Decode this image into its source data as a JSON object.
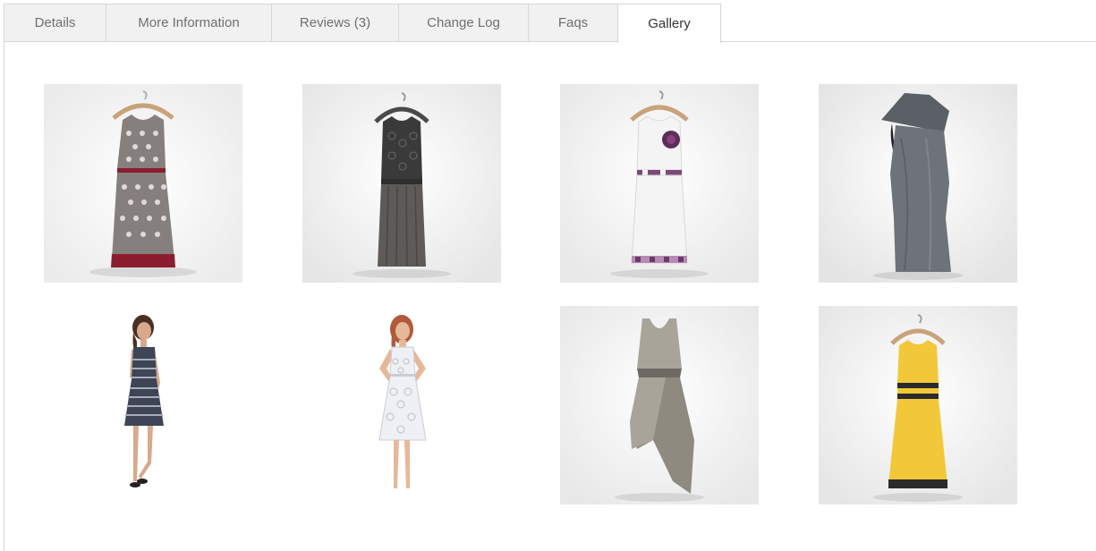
{
  "tabs": [
    {
      "label": "Details",
      "active": false
    },
    {
      "label": "More Information",
      "active": false
    },
    {
      "label": "Reviews (3)",
      "active": false
    },
    {
      "label": "Change Log",
      "active": false
    },
    {
      "label": "Faqs",
      "active": false
    },
    {
      "label": "Gallery",
      "active": true
    }
  ],
  "gallery": {
    "items": [
      {
        "name": "patterned-sleeveless-dress-on-hanger-thumbnail",
        "colors": {
          "main": "#85807e",
          "accent": "#8b1d2e"
        }
      },
      {
        "name": "dark-lace-maxi-dress-on-hanger-thumbnail",
        "colors": {
          "main": "#5e5a57",
          "accent": "#3a3a3a"
        }
      },
      {
        "name": "white-dress-with-pink-trim-on-hanger-thumbnail",
        "colors": {
          "main": "#f4f4f4",
          "accent": "#b78ab6"
        }
      },
      {
        "name": "grey-cowl-neck-fitted-dress-thumbnail",
        "colors": {
          "main": "#6d7378",
          "accent": "#5a6066"
        }
      },
      {
        "name": "woman-in-striped-navy-dress-thumbnail",
        "colors": {
          "main": "#3d4556",
          "accent": "#8a5a44"
        }
      },
      {
        "name": "woman-in-white-lace-cover-up-thumbnail",
        "colors": {
          "main": "#eef0f4",
          "accent": "#b05a3a"
        }
      },
      {
        "name": "taupe-high-low-dress-thumbnail",
        "colors": {
          "main": "#a9a49a",
          "accent": "#8f8a80"
        }
      },
      {
        "name": "yellow-dress-with-black-bands-on-hanger-thumbnail",
        "colors": {
          "main": "#f2c83a",
          "accent": "#2b2b2b"
        }
      }
    ]
  }
}
